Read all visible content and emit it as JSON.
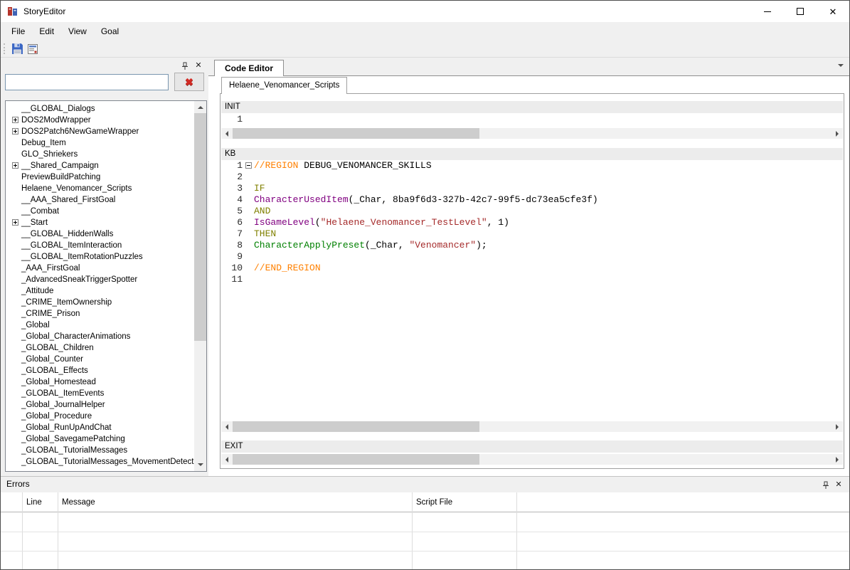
{
  "window": {
    "title": "StoryEditor"
  },
  "menu": {
    "items": [
      "File",
      "Edit",
      "View",
      "Goal"
    ]
  },
  "goals_panel": {
    "search_value": "",
    "tree_items": [
      {
        "label": "__GLOBAL_Dialogs",
        "expandable": false
      },
      {
        "label": "DOS2ModWrapper",
        "expandable": true
      },
      {
        "label": "DOS2Patch6NewGameWrapper",
        "expandable": true
      },
      {
        "label": "Debug_Item",
        "expandable": false
      },
      {
        "label": "GLO_Shriekers",
        "expandable": false
      },
      {
        "label": "__Shared_Campaign",
        "expandable": true
      },
      {
        "label": "PreviewBuildPatching",
        "expandable": false
      },
      {
        "label": "Helaene_Venomancer_Scripts",
        "expandable": false
      },
      {
        "label": "__AAA_Shared_FirstGoal",
        "expandable": false
      },
      {
        "label": "__Combat",
        "expandable": false
      },
      {
        "label": "__Start",
        "expandable": true
      },
      {
        "label": "__GLOBAL_HiddenWalls",
        "expandable": false
      },
      {
        "label": "__GLOBAL_ItemInteraction",
        "expandable": false
      },
      {
        "label": "__GLOBAL_ItemRotationPuzzles",
        "expandable": false
      },
      {
        "label": "_AAA_FirstGoal",
        "expandable": false
      },
      {
        "label": "_AdvancedSneakTriggerSpotter",
        "expandable": false
      },
      {
        "label": "_Attitude",
        "expandable": false
      },
      {
        "label": "_CRIME_ItemOwnership",
        "expandable": false
      },
      {
        "label": "_CRIME_Prison",
        "expandable": false
      },
      {
        "label": "_Global",
        "expandable": false
      },
      {
        "label": "_Global_CharacterAnimations",
        "expandable": false
      },
      {
        "label": "_GLOBAL_Children",
        "expandable": false
      },
      {
        "label": "_Global_Counter",
        "expandable": false
      },
      {
        "label": "_GLOBAL_Effects",
        "expandable": false
      },
      {
        "label": "_Global_Homestead",
        "expandable": false
      },
      {
        "label": "_GLOBAL_ItemEvents",
        "expandable": false
      },
      {
        "label": "_Global_JournalHelper",
        "expandable": false
      },
      {
        "label": "_Global_Procedure",
        "expandable": false
      },
      {
        "label": "_Global_RunUpAndChat",
        "expandable": false
      },
      {
        "label": "_Global_SavegamePatching",
        "expandable": false
      },
      {
        "label": "_GLOBAL_TutorialMessages",
        "expandable": false
      },
      {
        "label": "_GLOBAL_TutorialMessages_MovementDetection",
        "expandable": false
      }
    ]
  },
  "editor": {
    "main_tab_label": "Code Editor",
    "script_tab_label": "Helaene_Venomancer_Scripts",
    "init_label": "INIT",
    "kb_label": "KB",
    "exit_label": "EXIT",
    "syntax_colors": {
      "region": "#ff8000",
      "keyword": "#808000",
      "procedure": "#800080",
      "action": "#008000",
      "string": "#a52a2a",
      "plain": "#000000"
    },
    "init_lines": [
      {
        "num": 1,
        "tokens": []
      }
    ],
    "kb_lines": [
      {
        "num": 1,
        "fold": true,
        "tokens": [
          {
            "text": "//REGION",
            "type": "region"
          },
          {
            "text": " DEBUG_VENOMANCER_SKILLS",
            "type": "plain"
          }
        ]
      },
      {
        "num": 2,
        "tokens": []
      },
      {
        "num": 3,
        "tokens": [
          {
            "text": "IF",
            "type": "keyword"
          }
        ]
      },
      {
        "num": 4,
        "tokens": [
          {
            "text": "CharacterUsedItem",
            "type": "procedure"
          },
          {
            "text": "(_Char, 8ba9f6d3-327b-42c7-99f5-dc73ea5cfe3f)",
            "type": "plain"
          }
        ]
      },
      {
        "num": 5,
        "tokens": [
          {
            "text": "AND",
            "type": "keyword"
          }
        ]
      },
      {
        "num": 6,
        "tokens": [
          {
            "text": "IsGameLevel",
            "type": "procedure"
          },
          {
            "text": "(",
            "type": "plain"
          },
          {
            "text": "\"Helaene_Venomancer_TestLevel\"",
            "type": "string"
          },
          {
            "text": ", 1)",
            "type": "plain"
          }
        ]
      },
      {
        "num": 7,
        "tokens": [
          {
            "text": "THEN",
            "type": "keyword"
          }
        ]
      },
      {
        "num": 8,
        "tokens": [
          {
            "text": "CharacterApplyPreset",
            "type": "action"
          },
          {
            "text": "(_Char, ",
            "type": "plain"
          },
          {
            "text": "\"Venomancer\"",
            "type": "string"
          },
          {
            "text": ");",
            "type": "plain"
          }
        ]
      },
      {
        "num": 9,
        "tokens": []
      },
      {
        "num": 10,
        "tokens": [
          {
            "text": "//END_REGION",
            "type": "region"
          }
        ]
      },
      {
        "num": 11,
        "tokens": []
      }
    ]
  },
  "errors_panel": {
    "title": "Errors",
    "columns": [
      "Line",
      "Message",
      "Script File"
    ]
  }
}
